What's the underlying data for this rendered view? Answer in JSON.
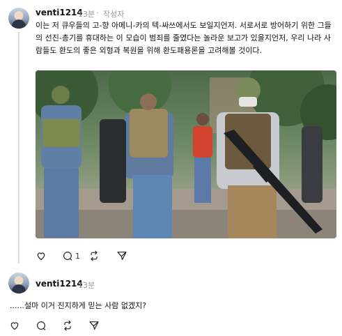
{
  "posts": [
    {
      "username": "venti1214",
      "time": "13분",
      "author_badge": "작성자",
      "text": "이는 저 큐우들의 고-향 아메니-카의 텍-싸쓰에서도 보일지언저. 서로서로 방어하기 위한 그들의 선진-총기를 휴대하는 이 모습이 범죄를 줄였다는 놀라운 보고가 있을지언저, 우리 나라 사람들도 환도의 좋은 외형과 복원을 위해 환도패용론을 고려해볼 것이다.",
      "actions": {
        "like_icon": "heart-icon",
        "reply_icon": "comment-icon",
        "reply_count": "1",
        "repost_icon": "repost-icon",
        "share_icon": "send-icon"
      }
    },
    {
      "username": "venti1214",
      "time": "13분",
      "text": "......설마 이거 진지하게 믿는 사람 없겠지?",
      "actions": {
        "like_icon": "heart-icon",
        "reply_icon": "comment-icon",
        "repost_icon": "repost-icon",
        "share_icon": "send-icon"
      }
    }
  ],
  "colors": {
    "text": "#101010",
    "muted": "#9a9a9a",
    "line": "#dcdcdc"
  }
}
